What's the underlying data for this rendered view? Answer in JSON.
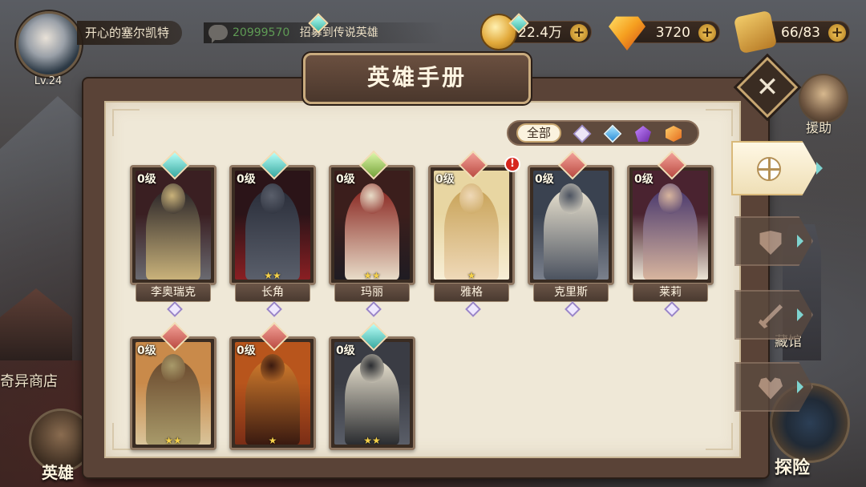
{
  "player": {
    "name": "开心的塞尔凯特",
    "level": "Lv.24"
  },
  "ticker": {
    "user_id": "20999570",
    "message": "招募到传说英雄"
  },
  "resources": {
    "gold": "22.4万",
    "gems": "3720",
    "stamina": "66/83",
    "plus": "+"
  },
  "codex": {
    "title": "英雄手册",
    "filter_all": "全部",
    "filters": [
      "white-gem",
      "blue-gem",
      "purple-gem",
      "orange-gem"
    ]
  },
  "side": {
    "close": "✕",
    "assist": "援助",
    "collection": "藏馆",
    "shop": "奇异商店",
    "heroes": "英雄",
    "explore": "探险"
  },
  "colors": {
    "panel_bg": "#efe8d7",
    "frame": "#5a4337",
    "accent_teal": "#3eb6a4",
    "star": "#f6d24a",
    "alert": "#d6261d"
  },
  "heroes": [
    {
      "name": "李奥瑞克",
      "level": "0级",
      "stars": "",
      "faction": "blue",
      "alert": false,
      "palette": [
        "#3a1f22",
        "#6a6a70",
        "#2a2528",
        "#c9b27a"
      ]
    },
    {
      "name": "长角",
      "level": "0级",
      "stars": "★★",
      "faction": "blue",
      "alert": false,
      "palette": [
        "#2b1418",
        "#8a1f23",
        "#2a2e3a",
        "#5a5f6b"
      ]
    },
    {
      "name": "玛丽",
      "level": "0级",
      "stars": "★★",
      "faction": "green",
      "alert": false,
      "palette": [
        "#3b1e1c",
        "#1f1c22",
        "#8b2a24",
        "#e8dcc8"
      ]
    },
    {
      "name": "雅格",
      "level": "0级",
      "stars": "★",
      "faction": "red",
      "alert": true,
      "alert_mark": "!",
      "palette": [
        "#e8d6a2",
        "#f7eed6",
        "#c9a45a",
        "#efd9b8"
      ]
    },
    {
      "name": "克里斯",
      "level": "0级",
      "stars": "",
      "faction": "red",
      "alert": false,
      "palette": [
        "#3a4250",
        "#7a808c",
        "#e6dfcd",
        "#4c5360"
      ]
    },
    {
      "name": "莱莉",
      "level": "0级",
      "stars": "",
      "faction": "red",
      "alert": false,
      "palette": [
        "#4a2330",
        "#ece4d4",
        "#4b3a6e",
        "#d8b59e"
      ]
    },
    {
      "name": "",
      "level": "0级",
      "stars": "★★",
      "faction": "red",
      "alert": false,
      "palette": [
        "#c98a4a",
        "#d9c49a",
        "#6b4a2e",
        "#a89a6a"
      ]
    },
    {
      "name": "",
      "level": "0级",
      "stars": "★",
      "faction": "red",
      "alert": false,
      "palette": [
        "#b8551c",
        "#7a2d16",
        "#d07a2c",
        "#3a1a10"
      ]
    },
    {
      "name": "",
      "level": "0级",
      "stars": "★★",
      "faction": "blue",
      "alert": false,
      "palette": [
        "#3a3c44",
        "#5a5e68",
        "#e6dfcd",
        "#2a2c30"
      ]
    }
  ]
}
